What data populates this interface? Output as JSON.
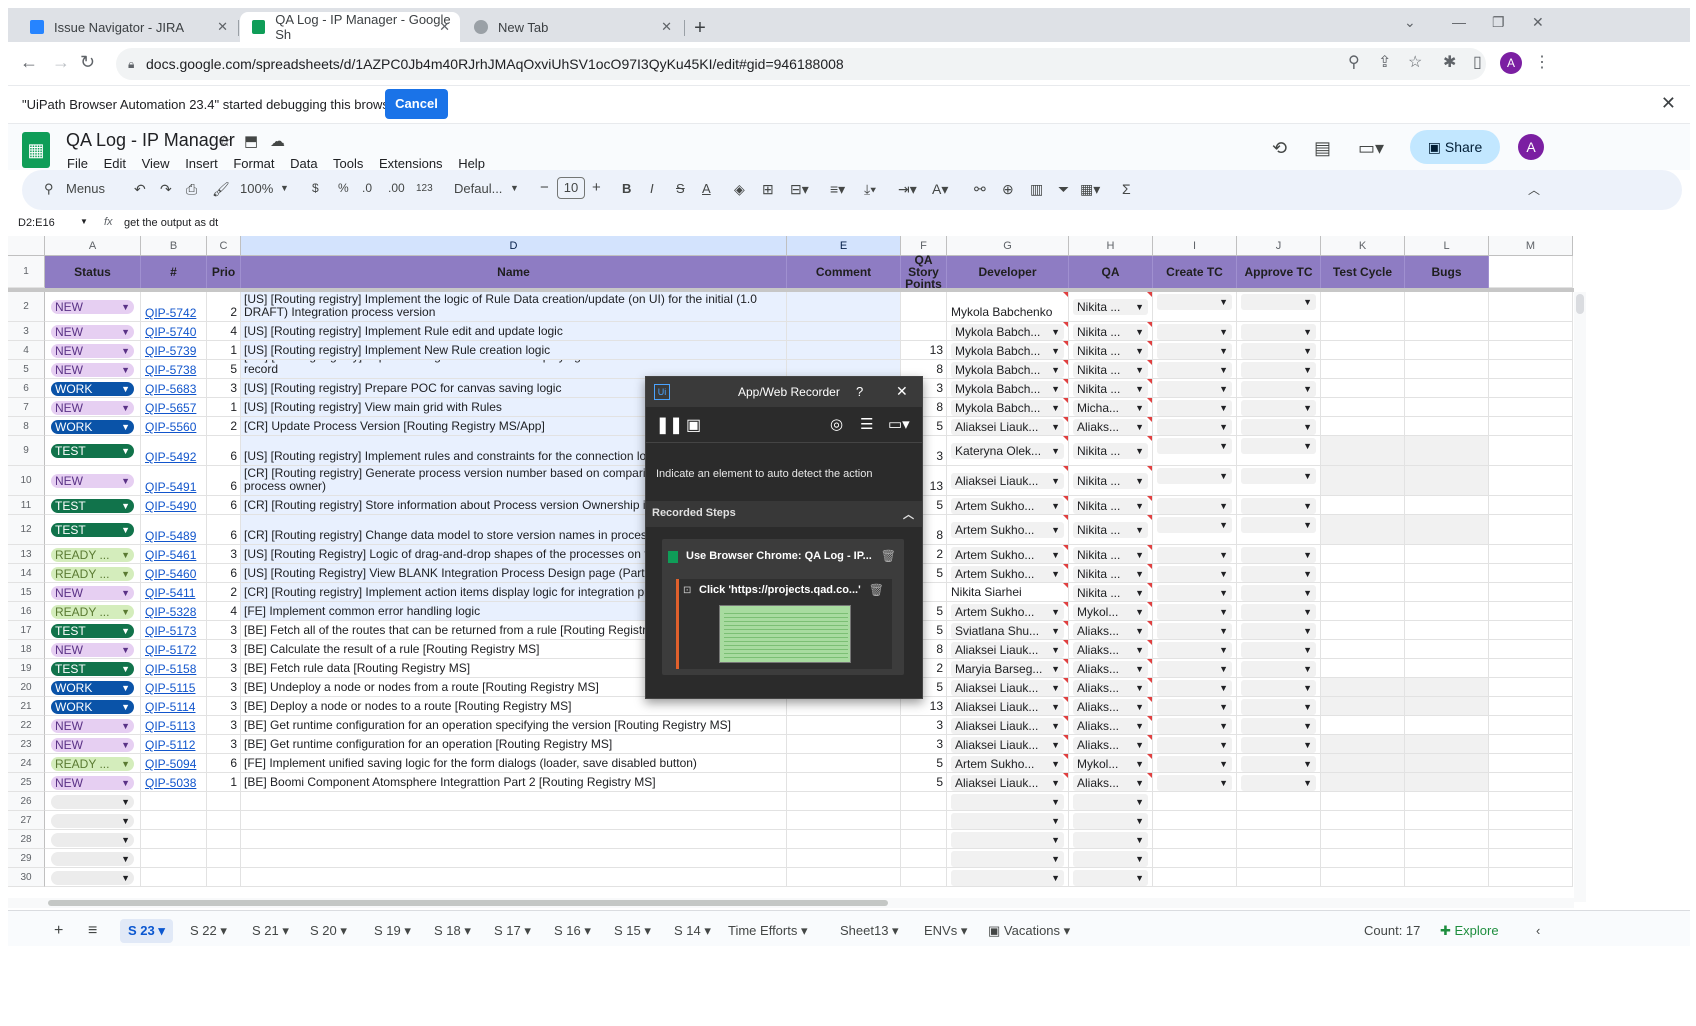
{
  "browser": {
    "tabs": [
      {
        "title": "Issue Navigator - JIRA"
      },
      {
        "title": "QA Log - IP Manager - Google Sh"
      },
      {
        "title": "New Tab"
      }
    ],
    "url": "docs.google.com/spreadsheets/d/1AZPC0Jb4m40RJrhJMAqOxviUhSV1ocO97I3QyKu45KI/edit#gid=946188008",
    "profile_initial": "A"
  },
  "debug_bar": {
    "message": "\"UiPath Browser Automation 23.4\" started debugging this browser",
    "cancel": "Cancel"
  },
  "sheet": {
    "title": "QA Log - IP Manager",
    "menus": [
      "File",
      "Edit",
      "View",
      "Insert",
      "Format",
      "Data",
      "Tools",
      "Extensions",
      "Help"
    ],
    "share": "Share",
    "avatar": "A",
    "toolbar": {
      "menus": "Menus",
      "zoom": "100%",
      "currency": "$",
      "percent": "%",
      "dec_less": ".0",
      "dec_more": ".00",
      "number_format": "123",
      "font": "Defaul...",
      "font_size": "10",
      "bold": "B",
      "italic": "I",
      "strike": "S",
      "text_color": "A"
    },
    "name_box": "D2:E16",
    "formula": "get the output as dt"
  },
  "columns": [
    "A",
    "B",
    "C",
    "D",
    "E",
    "F",
    "G",
    "H",
    "I",
    "J",
    "K",
    "L",
    "M"
  ],
  "headers": {
    "status": "Status",
    "num": "#",
    "prio": "Prio",
    "name": "Name",
    "comment": "Comment",
    "points": "QA Story Points",
    "developer": "Developer",
    "qa": "QA",
    "create_tc": "Create TC",
    "approve_tc": "Approve TC",
    "test_cycle": "Test Cycle",
    "bugs": "Bugs"
  },
  "rows": [
    {
      "n": "2",
      "status": "NEW",
      "id": "QIP-5742",
      "prio": "2",
      "name": "[US] [Routing registry] Implement the logic of Rule Data creation/update (on UI) for the initial (1.0 DRAFT) Integration process version",
      "points": "",
      "dev": "Mykola Babchenko",
      "qa": "Nikita ..."
    },
    {
      "n": "3",
      "status": "NEW",
      "id": "QIP-5740",
      "prio": "4",
      "name": "[US] [Routing registry] Implement Rule edit and update logic",
      "points": "",
      "dev": "Mykola Babch...",
      "qa": "Nikita ..."
    },
    {
      "n": "4",
      "status": "NEW",
      "id": "QIP-5739",
      "prio": "1",
      "name": "[US] [Routing registry] Implement New Rule creation logic",
      "points": "13",
      "dev": "Mykola Babch...",
      "qa": "Nikita ..."
    },
    {
      "n": "5",
      "status": "NEW",
      "id": "QIP-5738",
      "prio": "5",
      "name": "[CR] [Routing registry] Implement logic of action item displaying in the Actions items menu of the Rule record",
      "points": "8",
      "dev": "Mykola Babch...",
      "qa": "Nikita ..."
    },
    {
      "n": "6",
      "status": "WORK",
      "id": "QIP-5683",
      "prio": "3",
      "name": "[US] [Routing registry] Prepare POC for canvas saving logic",
      "points": "3",
      "dev": "Mykola Babch...",
      "qa": "Nikita ..."
    },
    {
      "n": "7",
      "status": "NEW",
      "id": "QIP-5657",
      "prio": "1",
      "name": "[US] [Routing registry] View main grid with Rules",
      "points": "8",
      "dev": "Mykola Babch...",
      "qa": "Micha..."
    },
    {
      "n": "8",
      "status": "WORK",
      "id": "QIP-5560",
      "prio": "2",
      "name": "[CR] Update Process Version [Routing Registry MS/App]",
      "points": "5",
      "dev": "Aliaksei Liauk...",
      "qa": "Aliaks..."
    },
    {
      "n": "9",
      "status": "TEST",
      "id": "QIP-5492",
      "prio": "6",
      "name": "[US] [Routing registry] Implement rules and constraints for the connection logic of (canvas area)",
      "points": "3",
      "dev": "Kateryna Olek...",
      "qa": "Nikita ..."
    },
    {
      "n": "10",
      "status": "NEW",
      "id": "QIP-5491",
      "prio": "6",
      "name": "[CR] [Routing registry] Generate process version number based on comparison w (when tenant is process owner)",
      "points": "13",
      "dev": "Aliaksei Liauk...",
      "qa": "Nikita ..."
    },
    {
      "n": "11",
      "status": "TEST",
      "id": "QIP-5490",
      "prio": "6",
      "name": "[CR] [Routing registry] Store information about Process version Ownership in proc",
      "points": "5",
      "dev": "Artem Sukho...",
      "qa": "Nikita ..."
    },
    {
      "n": "12",
      "status": "TEST",
      "id": "QIP-5489",
      "prio": "6",
      "name": "[CR] [Routing registry] Change data model to store version names in process_ver process table",
      "points": "8",
      "dev": "Artem Sukho...",
      "qa": "Nikita ..."
    },
    {
      "n": "13",
      "status": "READY ...",
      "id": "QIP-5461",
      "prio": "3",
      "name": "[US] [Routing Registry] Logic of drag-and-drop shapes of the processes on the ca",
      "points": "2",
      "dev": "Artem Sukho...",
      "qa": "Nikita ..."
    },
    {
      "n": "14",
      "status": "READY ...",
      "id": "QIP-5460",
      "prio": "6",
      "name": "[US] [Routing Registry] View BLANK Integration Process Design page (Part 2)",
      "points": "5",
      "dev": "Artem Sukho...",
      "qa": "Nikita ..."
    },
    {
      "n": "15",
      "status": "NEW",
      "id": "QIP-5411",
      "prio": "2",
      "name": "[CR] [Routing registry] Implement action items display logic for integration process",
      "points": "",
      "dev": "Nikita Siarhei",
      "qa": "Nikita ..."
    },
    {
      "n": "16",
      "status": "READY ...",
      "id": "QIP-5328",
      "prio": "4",
      "name": "[FE] Implement common error handling logic",
      "points": "5",
      "dev": "Artem Sukho...",
      "qa": "Mykol..."
    },
    {
      "n": "17",
      "status": "TEST",
      "id": "QIP-5173",
      "prio": "3",
      "name": "[BE] Fetch all of the routes that can be returned from a rule [Routing Registry MS]",
      "points": "5",
      "dev": "Sviatlana Shu...",
      "qa": "Aliaks..."
    },
    {
      "n": "18",
      "status": "NEW",
      "id": "QIP-5172",
      "prio": "3",
      "name": "[BE] Calculate the result of a rule [Routing Registry MS]",
      "points": "8",
      "dev": "Aliaksei Liauk...",
      "qa": "Aliaks..."
    },
    {
      "n": "19",
      "status": "TEST",
      "id": "QIP-5158",
      "prio": "3",
      "name": "[BE] Fetch rule data [Routing Registry MS]",
      "points": "2",
      "dev": "Maryia Barseg...",
      "qa": "Aliaks..."
    },
    {
      "n": "20",
      "status": "WORK",
      "id": "QIP-5115",
      "prio": "3",
      "name": "[BE] Undeploy a node or nodes from a route [Routing Registry MS]",
      "points": "5",
      "dev": "Aliaksei Liauk...",
      "qa": "Aliaks..."
    },
    {
      "n": "21",
      "status": "WORK",
      "id": "QIP-5114",
      "prio": "3",
      "name": "[BE] Deploy a node or nodes to a route [Routing Registry MS]",
      "points": "13",
      "dev": "Aliaksei Liauk...",
      "qa": "Aliaks..."
    },
    {
      "n": "22",
      "status": "NEW",
      "id": "QIP-5113",
      "prio": "3",
      "name": "[BE] Get runtime configuration for an operation specifying the version [Routing Registry MS]",
      "points": "3",
      "dev": "Aliaksei Liauk...",
      "qa": "Aliaks..."
    },
    {
      "n": "23",
      "status": "NEW",
      "id": "QIP-5112",
      "prio": "3",
      "name": "[BE] Get runtime configuration for an operation [Routing Registry MS]",
      "points": "3",
      "dev": "Aliaksei Liauk...",
      "qa": "Aliaks..."
    },
    {
      "n": "24",
      "status": "READY ...",
      "id": "QIP-5094",
      "prio": "6",
      "name": "[FE] Implement unified saving logic for the form dialogs (loader, save disabled button)",
      "points": "5",
      "dev": "Artem Sukho...",
      "qa": "Mykol..."
    },
    {
      "n": "25",
      "status": "NEW",
      "id": "QIP-5038",
      "prio": "1",
      "name": "[BE] Boomi Component Atomsphere Integrattion Part 2 [Routing Registry MS]",
      "points": "5",
      "dev": "Aliaksei Liauk...",
      "qa": "Aliaks..."
    },
    {
      "n": "26",
      "status": "",
      "id": "",
      "prio": "",
      "name": "",
      "points": "",
      "dev": "",
      "qa": ""
    },
    {
      "n": "27",
      "status": "",
      "id": "",
      "prio": "",
      "name": "",
      "points": "",
      "dev": "",
      "qa": ""
    },
    {
      "n": "28",
      "status": "",
      "id": "",
      "prio": "",
      "name": "",
      "points": "",
      "dev": "",
      "qa": ""
    },
    {
      "n": "29",
      "status": "",
      "id": "",
      "prio": "",
      "name": "",
      "points": "",
      "dev": "",
      "qa": ""
    },
    {
      "n": "30",
      "status": "",
      "id": "",
      "prio": "",
      "name": "",
      "points": "",
      "dev": "",
      "qa": ""
    }
  ],
  "sheet_tabs": [
    "S 23",
    "S 22",
    "S 21",
    "S 20",
    "S 19",
    "S 18",
    "S 17",
    "S 16",
    "S 15",
    "S 14",
    "Time Efforts",
    "Sheet13",
    "ENVs",
    "Vacations"
  ],
  "count": "Count: 17",
  "explore": "Explore",
  "recorder": {
    "title": "App/Web Recorder",
    "help": "?",
    "hint": "Indicate an element to auto detect the action",
    "steps_title": "Recorded Steps",
    "step_scope": "Use Browser Chrome: QA Log - IP...",
    "step_click": "Click 'https://projects.qad.co...'"
  }
}
